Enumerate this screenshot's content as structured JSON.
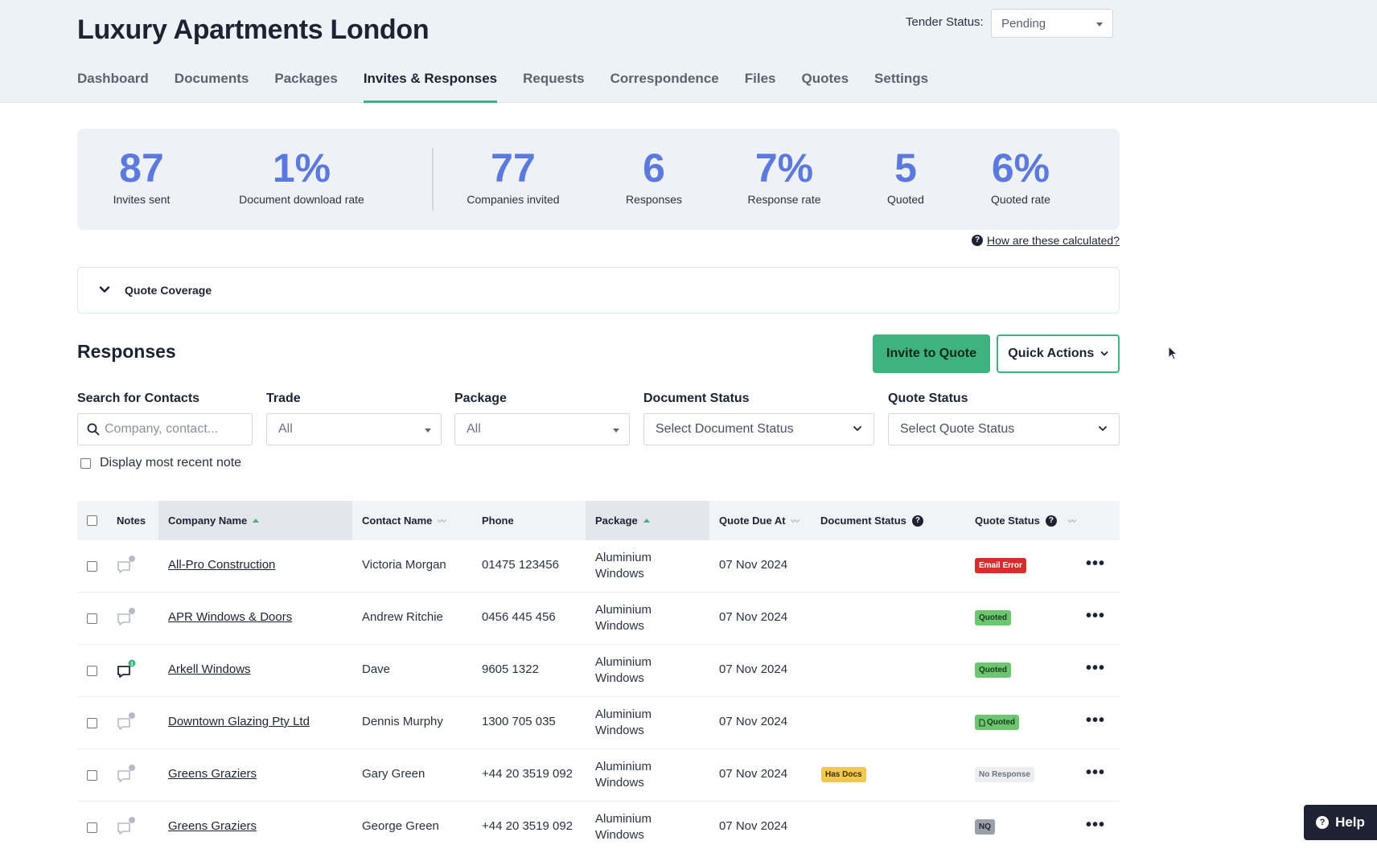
{
  "project": {
    "title": "Luxury Apartments London"
  },
  "tender": {
    "label": "Tender Status:",
    "value": "Pending"
  },
  "tabs": [
    {
      "label": "Dashboard"
    },
    {
      "label": "Documents"
    },
    {
      "label": "Packages"
    },
    {
      "label": "Invites & Responses",
      "active": true
    },
    {
      "label": "Requests"
    },
    {
      "label": "Correspondence"
    },
    {
      "label": "Files"
    },
    {
      "label": "Quotes"
    },
    {
      "label": "Settings"
    }
  ],
  "stats": [
    {
      "value": "87",
      "label": "Invites sent"
    },
    {
      "value": "1%",
      "label": "Document download rate"
    },
    {
      "value": "77",
      "label": "Companies invited"
    },
    {
      "value": "6",
      "label": "Responses"
    },
    {
      "value": "7%",
      "label": "Response rate"
    },
    {
      "value": "5",
      "label": "Quoted"
    },
    {
      "value": "6%",
      "label": "Quoted rate"
    }
  ],
  "calc_link": "How are these calculated?",
  "coverage": {
    "label": "Quote Coverage"
  },
  "responses": {
    "title": "Responses",
    "invite_button": "Invite to Quote",
    "quick_actions": "Quick Actions"
  },
  "filters": {
    "search": {
      "label": "Search for Contacts",
      "placeholder": "Company, contact..."
    },
    "trade": {
      "label": "Trade",
      "value": "All"
    },
    "package": {
      "label": "Package",
      "value": "All"
    },
    "document_status": {
      "label": "Document Status",
      "value": "Select Document Status"
    },
    "quote_status": {
      "label": "Quote Status",
      "value": "Select Quote Status"
    },
    "recent_note": "Display most recent note"
  },
  "table": {
    "headers": {
      "notes": "Notes",
      "company": "Company Name",
      "contact": "Contact Name",
      "phone": "Phone",
      "package": "Package",
      "due": "Quote Due At",
      "doc_status": "Document Status",
      "quote_status": "Quote Status"
    },
    "rows": [
      {
        "company": "All-Pro Construction",
        "contact": "Victoria Morgan",
        "phone": "01475 123456",
        "package_l1": "Aluminium",
        "package_l2": "Windows",
        "due": "07 Nov 2024",
        "doc_status": "",
        "quote_status": "Email Error",
        "note_count": ""
      },
      {
        "company": "APR Windows & Doors",
        "contact": "Andrew Ritchie",
        "phone": "0456 445 456",
        "package_l1": "Aluminium",
        "package_l2": "Windows",
        "due": "07 Nov 2024",
        "doc_status": "",
        "quote_status": "Quoted",
        "note_count": ""
      },
      {
        "company": "Arkell Windows",
        "contact": "Dave",
        "phone": "9605 1322",
        "package_l1": "Aluminium",
        "package_l2": "Windows",
        "due": "07 Nov 2024",
        "doc_status": "",
        "quote_status": "Quoted",
        "note_count": "1"
      },
      {
        "company": "Downtown Glazing Pty Ltd",
        "contact": "Dennis Murphy",
        "phone": "1300 705 035",
        "package_l1": "Aluminium",
        "package_l2": "Windows",
        "due": "07 Nov 2024",
        "doc_status": "",
        "quote_status": "Quoted",
        "note_count": ""
      },
      {
        "company": "Greens Graziers",
        "contact": "Gary Green",
        "phone": "+44 20 3519 092",
        "package_l1": "Aluminium",
        "package_l2": "Windows",
        "due": "07 Nov 2024",
        "doc_status": "Has Docs",
        "quote_status": "No Response",
        "note_count": ""
      },
      {
        "company": "Greens Graziers",
        "contact": "George Green",
        "phone": "+44 20 3519 092",
        "package_l1": "Aluminium",
        "package_l2": "Windows",
        "due": "07 Nov 2024",
        "doc_status": "",
        "quote_status": "NQ",
        "note_count": ""
      }
    ]
  },
  "colors": {
    "accent_green": "#3fb27f",
    "stat_blue": "#5b79df",
    "email_error": "#d92d2d",
    "quoted": "#6cc56f",
    "has_docs": "#f2c94c",
    "no_response": "#eeeeee",
    "nq": "#9aa0a8"
  },
  "help": {
    "label": "Help"
  }
}
